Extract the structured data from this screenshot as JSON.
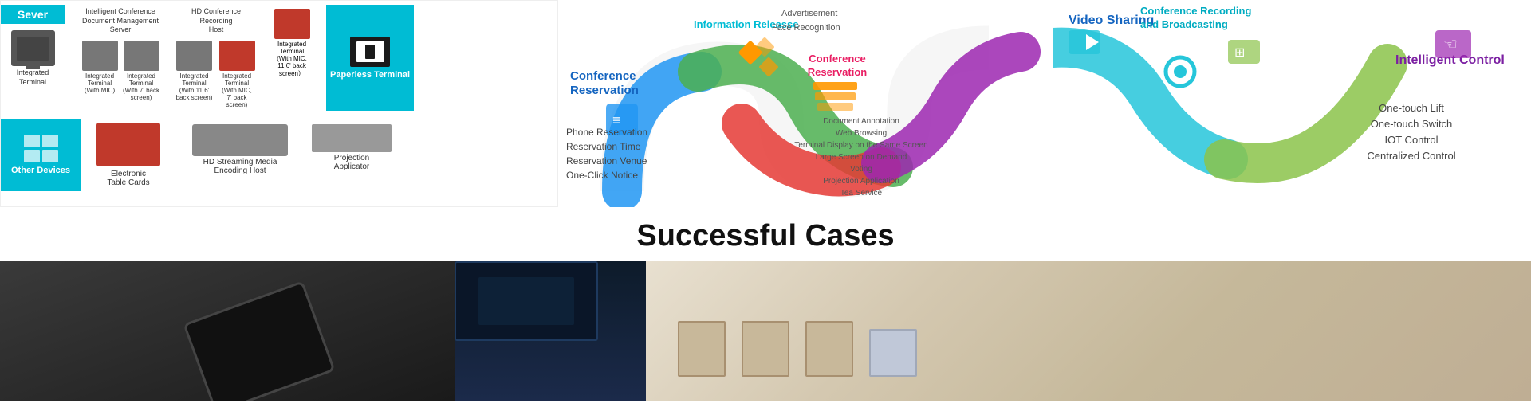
{
  "layout": {
    "top": {
      "left": {
        "sever_label": "Sever",
        "devices": [
          {
            "label": "Integrated Terminal",
            "type": "monitor"
          },
          {
            "label": "Integrated Terminal (With MIC)",
            "type": "monitor"
          },
          {
            "label": "Integrated Terminal (With 7' back screen)",
            "type": "monitor"
          },
          {
            "label": "Integrated Terminal (With 11.6' back screen)",
            "type": "monitor"
          },
          {
            "label": "Integrated Terminal (With MIC, 7' back screen)",
            "type": "monitor"
          },
          {
            "label": "Integrated Terminal (With MIC, 11.6' back screen ）",
            "type": "monitor"
          }
        ],
        "paperless": {
          "label": "Paperless Terminal"
        },
        "server_items": [
          {
            "label": "Intelligent Conference Document Management Server"
          },
          {
            "label": "HD Conference Recording Host"
          }
        ],
        "other_devices": {
          "label": "Other Devices"
        },
        "row2_items": [
          {
            "label": "Electronic Table Cards"
          },
          {
            "label": "HD Streaming Media Encoding Host"
          },
          {
            "label": "Projection Applicator"
          }
        ]
      },
      "middle": {
        "conf_reservation": "Conference Reservation",
        "info_release": "Information Releasse",
        "conf_reservation2": "Conference Reservation",
        "advertisement": "Advertisement",
        "face_recognition": "Face Recognition",
        "video_sharing": "Video Sharing",
        "conf_recording": "Conference Recording and Broadcasting",
        "phone_reservation": "Phone Reservation",
        "reservation_time": "Reservation Time",
        "reservation_venue": "Reservation Venue",
        "one_click_notice": "One-Click Notice",
        "document_annotation": "Document Annotation",
        "web_browsing": "Web Browsing",
        "terminal_display": "Terminal Display on the Same Screen",
        "large_screen": "Large Screen on Demand",
        "voting": "Voting",
        "projection_app": "Projection Application",
        "tea_service": "Tea Service"
      },
      "right": {
        "video_sharing": "Video Sharing",
        "conf_recording_broadcasting": "Conference Recording and Broadcasting",
        "intelligent_control": "Intelligent Control",
        "one_touch_lift": "One-touch Lift",
        "one_touch_switch": "One-touch Switch",
        "iot_control": "IOT Control",
        "centralized_control": "Centralized Control"
      }
    },
    "successful_cases": {
      "title": "Successful Cases"
    }
  }
}
